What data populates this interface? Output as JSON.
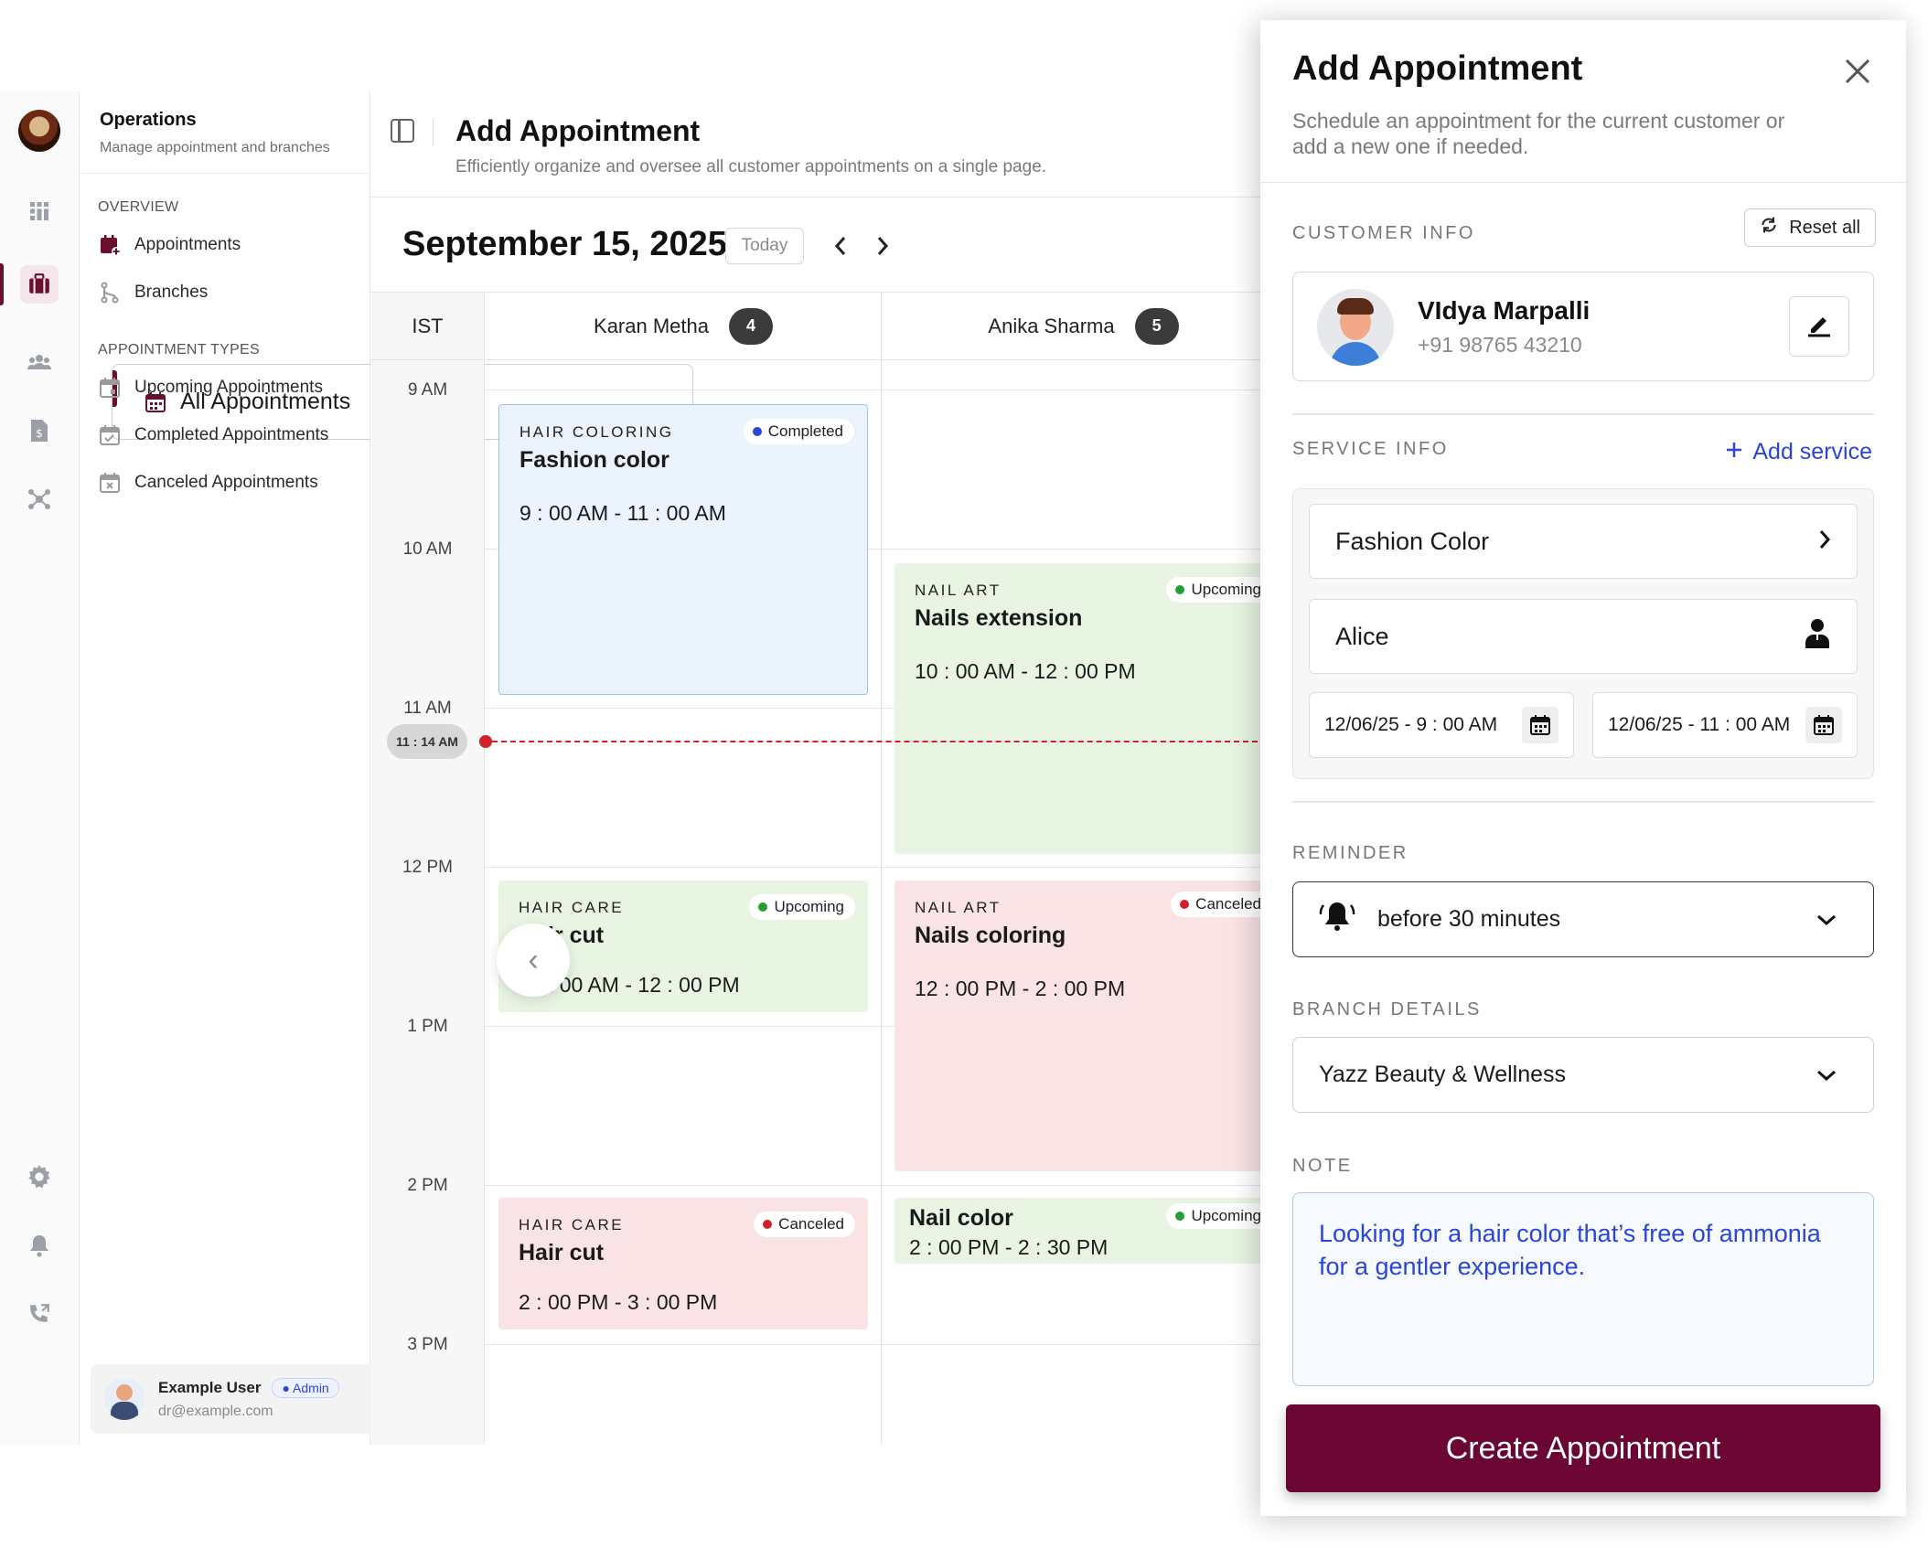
{
  "sidebar": {
    "title": "Operations",
    "subtitle": "Manage appointment and branches",
    "overview_label": "OVERVIEW",
    "overview_items": [
      {
        "label": "Appointments",
        "icon": "calendar-plus-icon"
      },
      {
        "label": "Branches",
        "icon": "branch-icon"
      }
    ],
    "types_label": "APPOINTMENT TYPES",
    "type_items": [
      {
        "label": "All Appointments",
        "icon": "calendar-grid-icon",
        "selected": true
      },
      {
        "label": "Upcoming Appointments",
        "icon": "calendar-icon"
      },
      {
        "label": "Completed Appointments",
        "icon": "calendar-check-icon"
      },
      {
        "label": "Canceled Appointments",
        "icon": "calendar-x-icon"
      }
    ],
    "user": {
      "name": "Example User",
      "role": "Admin",
      "email": "dr@example.com"
    }
  },
  "rail": {
    "icons": [
      "grid-icon",
      "briefcase-icon",
      "people-icon",
      "invoice-icon",
      "network-icon",
      "settings-icon",
      "bell-icon",
      "phone-icon"
    ],
    "active": "briefcase-icon"
  },
  "header": {
    "title": "Add Appointment",
    "subtitle": "Efficiently organize and oversee all customer appointments on a single page."
  },
  "calendar": {
    "date": "September 15, 2025",
    "today_label": "Today",
    "prev": "‹",
    "next": "›",
    "timezone": "IST",
    "hours": [
      "9 AM",
      "10 AM",
      "11 AM",
      "12 PM",
      "1 PM",
      "2 PM",
      "3 PM"
    ],
    "now_label": "11 : 14 AM",
    "staff": [
      {
        "name": "Karan Metha",
        "count": "4"
      },
      {
        "name": "Anika Sharma",
        "count": "5"
      }
    ],
    "events": [
      {
        "category": "HAIR COLORING",
        "title": "Fashion color",
        "time": "9 : 00 AM - 11 : 00 AM",
        "status": "Completed",
        "status_color": "#2b45d4",
        "tone": "blue"
      },
      {
        "category": "NAIL ART",
        "title": "Nails extension",
        "time": "10 : 00 AM - 12 : 00 PM",
        "status": "Upcoming",
        "status_color": "#22a033",
        "tone": "green"
      },
      {
        "category": "HAIR CARE",
        "title": "Hair cut",
        "time": "10 : 00 AM - 12 : 00 PM",
        "status": "Upcoming",
        "status_color": "#22a033",
        "tone": "green"
      },
      {
        "category": "NAIL ART",
        "title": "Nails coloring",
        "time": "12 : 00 PM - 2 : 00 PM",
        "status": "Canceled",
        "status_color": "#d0202a",
        "tone": "red"
      },
      {
        "category": "HAIR CARE",
        "title": "Hair cut",
        "time": "2 : 00 PM - 3 : 00 PM",
        "status": "Canceled",
        "status_color": "#d0202a",
        "tone": "red"
      },
      {
        "category": "",
        "title": "Nail color",
        "time": "2 : 00 PM - 2 : 30 PM",
        "status": "Upcoming",
        "status_color": "#22a033",
        "tone": "green"
      }
    ]
  },
  "drawer": {
    "title": "Add Appointment",
    "subtitle": "Schedule an appointment for the current customer or add a new one if needed.",
    "customer_label": "CUSTOMER INFO",
    "reset_label": "Reset all",
    "customer": {
      "name": "VIdya Marpalli",
      "phone": "+91 98765 43210"
    },
    "service_label": "SERVICE INFO",
    "add_service_label": "Add service",
    "service": "Fashion Color",
    "stylist": "Alice",
    "start": "12/06/25 - 9 : 00 AM",
    "end": "12/06/25 - 11 : 00 AM",
    "reminder_label": "REMINDER",
    "reminder": "before 30 minutes",
    "branch_label": "BRANCH DETAILS",
    "branch": "Yazz Beauty & Wellness",
    "note_label": "NOTE",
    "note": "Looking for a hair color that’s free of ammonia for a gentler experience.",
    "submit_label": "Create Appointment"
  },
  "colors": {
    "brand": "#6b0634",
    "accent": "#2b45d4",
    "completed": "#2b45d4",
    "upcoming": "#22a033",
    "canceled": "#d0202a"
  }
}
